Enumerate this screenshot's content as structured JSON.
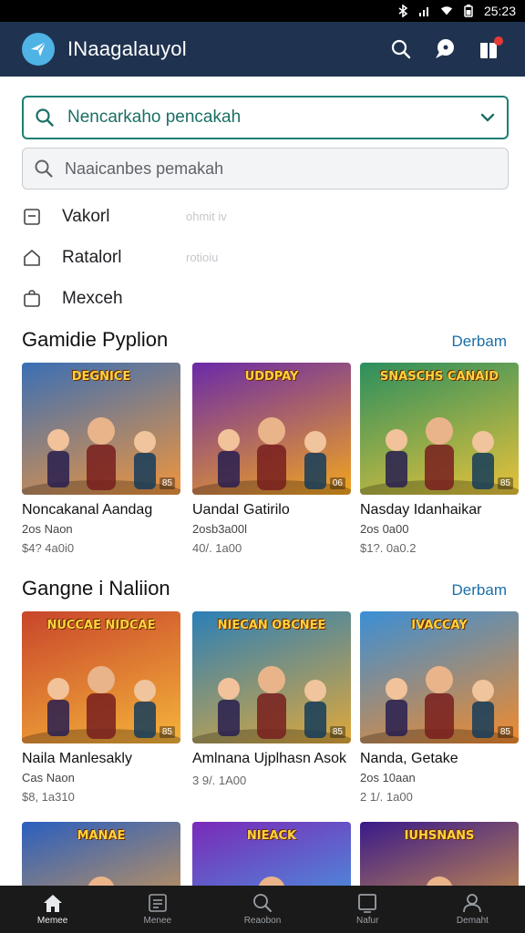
{
  "status_bar": {
    "time": "25:23"
  },
  "app": {
    "title": "INaagalauyol"
  },
  "search_primary": {
    "text": "Nencarkaho pencakah"
  },
  "search_secondary": {
    "placeholder": "Naaicanbes pemakah"
  },
  "menu": [
    {
      "label": "Vakorl",
      "note": "ohmit iv",
      "icon": "square-outline-icon"
    },
    {
      "label": "Ratalorl",
      "note": "rotioiu",
      "icon": "house-outline-icon"
    },
    {
      "label": "Mexceh",
      "note": "",
      "icon": "bag-outline-icon"
    }
  ],
  "sections": [
    {
      "title": "Gamidie Pyplion",
      "link": "Derbam",
      "cards": [
        {
          "name": "Noncakanal Aandag",
          "meta": "2os Naon",
          "price": "$4? 4a0i0",
          "badge": "85",
          "thumb_title": "DEGNICE",
          "colors": [
            "#3a6fb5",
            "#f0953d"
          ]
        },
        {
          "name": "UandaI Gatirilo",
          "meta": "2osb3a00l",
          "price": "40/. 1a00",
          "badge": "06",
          "thumb_title": "UDDPAY",
          "colors": [
            "#6a2aa8",
            "#f2a51f"
          ]
        },
        {
          "name": "Nasday Idanhaikar",
          "meta": "2os 0a00",
          "price": "$1?. 0a0.2",
          "badge": "85",
          "thumb_title": "SNASCHS CANAID",
          "colors": [
            "#2b8f5e",
            "#e8c23a"
          ]
        }
      ]
    },
    {
      "title": "Gangne i Naliion",
      "link": "Derbam",
      "cards": [
        {
          "name": "Naila Manlesakly",
          "meta": "Cas Naon",
          "price": "$8, 1a310",
          "badge": "85",
          "thumb_title": "NUCCAE NIDCAE",
          "colors": [
            "#c8452b",
            "#f5b43a"
          ]
        },
        {
          "name": "Amlnana Ujplhasn Asok",
          "meta": "",
          "price": "3 9/. 1A00",
          "badge": "85",
          "thumb_title": "NIECAN OBCNEE",
          "colors": [
            "#2a7fb8",
            "#e0a83a"
          ]
        },
        {
          "name": "Nanda, Getake",
          "meta": "2os 10aan",
          "price": "2 1/. 1a00",
          "badge": "85",
          "thumb_title": "IVACCAY",
          "colors": [
            "#3a8fd6",
            "#f28a2b"
          ]
        }
      ]
    },
    {
      "title": "",
      "link": "",
      "cards": [
        {
          "name": "",
          "meta": "",
          "price": "",
          "badge": "",
          "thumb_title": "MANAE",
          "colors": [
            "#2a5fbf",
            "#f5a53a"
          ]
        },
        {
          "name": "",
          "meta": "",
          "price": "",
          "badge": "",
          "thumb_title": "NIEACK",
          "colors": [
            "#7a2ab8",
            "#3ab2e8"
          ]
        },
        {
          "name": "",
          "meta": "",
          "price": "",
          "badge": "",
          "thumb_title": "IUHSNANS",
          "colors": [
            "#3a1a8a",
            "#f2b13a"
          ]
        }
      ]
    }
  ],
  "bottom_nav": [
    {
      "label": "Memee",
      "icon": "home-icon",
      "active": true
    },
    {
      "label": "Menee",
      "icon": "list-icon",
      "active": false
    },
    {
      "label": "Reaobon",
      "icon": "search-icon",
      "active": false
    },
    {
      "label": "Nafur",
      "icon": "square-icon",
      "active": false
    },
    {
      "label": "Demaht",
      "icon": "profile-icon",
      "active": false
    }
  ]
}
